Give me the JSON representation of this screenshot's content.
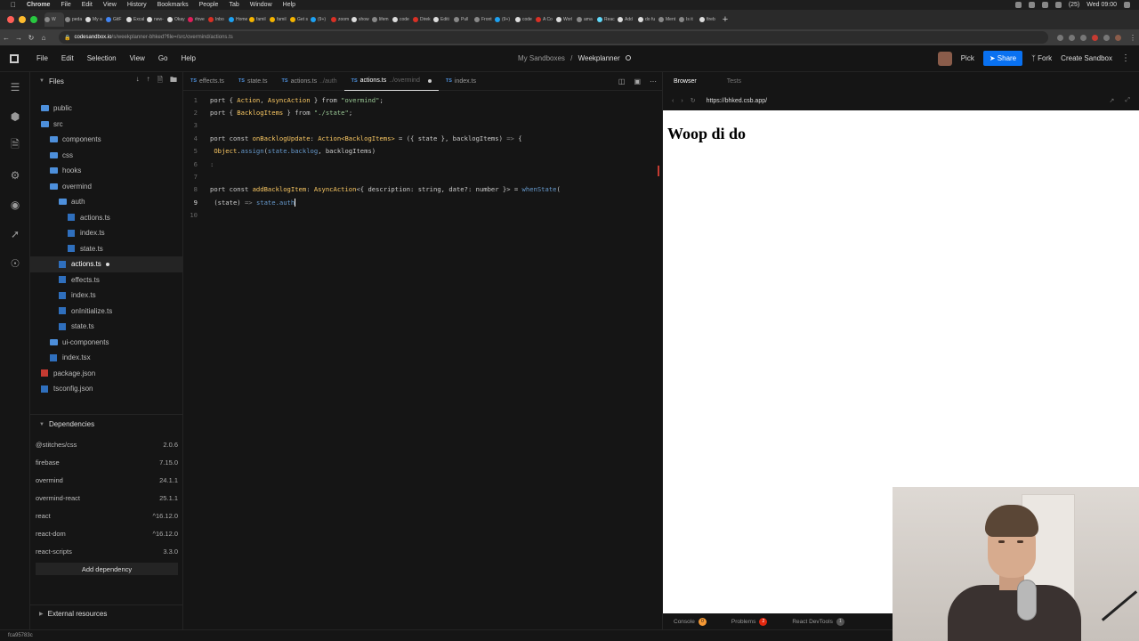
{
  "macbar": {
    "app": "Chrome",
    "menus": [
      "File",
      "Edit",
      "View",
      "History",
      "Bookmarks",
      "People",
      "Tab",
      "Window",
      "Help"
    ],
    "clock": "Wed 09:00",
    "notif": "(25)"
  },
  "chrome": {
    "tabs": [
      {
        "label": "W",
        "color": "#888888"
      },
      {
        "label": "peda",
        "color": "#888888"
      },
      {
        "label": "My a",
        "color": "#dddddd"
      },
      {
        "label": "GitF",
        "color": "#4285f4"
      },
      {
        "label": "Excal",
        "color": "#dddddd"
      },
      {
        "label": "new-",
        "color": "#dddddd"
      },
      {
        "label": "Okay",
        "color": "#dddddd"
      },
      {
        "label": "#ove",
        "color": "#e01e5a"
      },
      {
        "label": "Inbo",
        "color": "#d93025"
      },
      {
        "label": "Home",
        "color": "#1da1f2"
      },
      {
        "label": "famil",
        "color": "#f4b400"
      },
      {
        "label": "famil",
        "color": "#f4b400"
      },
      {
        "label": "Get s",
        "color": "#f4b400"
      },
      {
        "label": "(9+)",
        "color": "#1da1f2"
      },
      {
        "label": "zoom",
        "color": "#d93025"
      },
      {
        "label": "show",
        "color": "#dddddd"
      },
      {
        "label": "lifem",
        "color": "#888888"
      },
      {
        "label": "code",
        "color": "#dddddd"
      },
      {
        "label": "Direk",
        "color": "#d93025"
      },
      {
        "label": "Editi",
        "color": "#dddddd"
      },
      {
        "label": "Pull",
        "color": "#888888"
      },
      {
        "label": "Front",
        "color": "#888888"
      },
      {
        "label": "(9+)",
        "color": "#1da1f2"
      },
      {
        "label": "code",
        "color": "#dddddd"
      },
      {
        "label": "A Co",
        "color": "#d93025"
      },
      {
        "label": "Worl",
        "color": "#dddddd"
      },
      {
        "label": "ama",
        "color": "#888888"
      },
      {
        "label": "Reac",
        "color": "#61dafb"
      },
      {
        "label": "Add",
        "color": "#dddddd"
      },
      {
        "label": "do fu",
        "color": "#dddddd"
      },
      {
        "label": "Ment",
        "color": "#888888"
      },
      {
        "label": "Is it",
        "color": "#888888"
      },
      {
        "label": "fireb",
        "color": "#dddddd"
      }
    ],
    "url_prefix": "codesandbox.io",
    "url_path": "/s/weekplanner-bhked?file=/src/overmind/actions.ts"
  },
  "csheader": {
    "menu": [
      "File",
      "Edit",
      "Selection",
      "View",
      "Go",
      "Help"
    ],
    "crumb_parent": "My Sandboxes",
    "crumb_sep": "/",
    "crumb_current": "Weekplanner",
    "pick": "Pick",
    "share": "Share",
    "fork": "Fork",
    "create": "Create Sandbox"
  },
  "sidebar": {
    "title": "Files",
    "tree": [
      {
        "name": "public",
        "type": "folder",
        "indent": 0
      },
      {
        "name": "src",
        "type": "folder",
        "indent": 0
      },
      {
        "name": "components",
        "type": "folder",
        "indent": 1
      },
      {
        "name": "css",
        "type": "folder",
        "indent": 1
      },
      {
        "name": "hooks",
        "type": "folder",
        "indent": 1
      },
      {
        "name": "overmind",
        "type": "folder",
        "indent": 1
      },
      {
        "name": "auth",
        "type": "folder",
        "indent": 2
      },
      {
        "name": "actions.ts",
        "type": "ts",
        "indent": 3
      },
      {
        "name": "index.ts",
        "type": "ts",
        "indent": 3
      },
      {
        "name": "state.ts",
        "type": "ts",
        "indent": 3
      },
      {
        "name": "actions.ts",
        "type": "ts",
        "indent": 2,
        "selected": true,
        "modified": true
      },
      {
        "name": "effects.ts",
        "type": "ts",
        "indent": 2
      },
      {
        "name": "index.ts",
        "type": "ts",
        "indent": 2
      },
      {
        "name": "onInitialize.ts",
        "type": "ts",
        "indent": 2
      },
      {
        "name": "state.ts",
        "type": "ts",
        "indent": 2
      },
      {
        "name": "ui-components",
        "type": "folder",
        "indent": 1
      },
      {
        "name": "index.tsx",
        "type": "ts",
        "indent": 1
      },
      {
        "name": "package.json",
        "type": "json",
        "indent": 0
      },
      {
        "name": "tsconfig.json",
        "type": "ts",
        "indent": 0
      }
    ],
    "dependencies_title": "Dependencies",
    "dependencies": [
      {
        "name": "@stitches/css",
        "version": "2.0.6"
      },
      {
        "name": "firebase",
        "version": "7.15.0"
      },
      {
        "name": "overmind",
        "version": "24.1.1"
      },
      {
        "name": "overmind-react",
        "version": "25.1.1"
      },
      {
        "name": "react",
        "version": "^16.12.0"
      },
      {
        "name": "react-dom",
        "version": "^16.12.0"
      },
      {
        "name": "react-scripts",
        "version": "3.3.0"
      }
    ],
    "add_dependency": "Add dependency",
    "external_resources": "External resources"
  },
  "editor": {
    "tabs": [
      {
        "name": "effects.ts",
        "sub": ""
      },
      {
        "name": "state.ts",
        "sub": ""
      },
      {
        "name": "actions.ts",
        "sub": "../auth"
      },
      {
        "name": "actions.ts",
        "sub": "../overmind",
        "active": true,
        "modified": true
      },
      {
        "name": "index.ts",
        "sub": ""
      }
    ],
    "lines": [
      {
        "n": "1",
        "parts": [
          [
            "kw",
            "port { "
          ],
          [
            "id",
            "Action"
          ],
          [
            "kw",
            ", "
          ],
          [
            "id",
            "AsyncAction"
          ],
          [
            "kw",
            " } from "
          ],
          [
            "str",
            "\"overmind\""
          ],
          [
            "kw",
            ";"
          ]
        ]
      },
      {
        "n": "2",
        "parts": [
          [
            "kw",
            "port { "
          ],
          [
            "id",
            "BacklogItems"
          ],
          [
            "kw",
            " } from "
          ],
          [
            "str",
            "\"./state\""
          ],
          [
            "kw",
            ";"
          ]
        ]
      },
      {
        "n": "3",
        "parts": []
      },
      {
        "n": "4",
        "parts": [
          [
            "kw",
            "port const "
          ],
          [
            "id",
            "onBacklogUpdate"
          ],
          [
            "kw",
            ": "
          ],
          [
            "typ",
            "Action<BacklogItems>"
          ],
          [
            "kw",
            " = ({ state }, backlogItems) "
          ],
          [
            "mut",
            "=>"
          ],
          [
            "kw",
            " {"
          ]
        ]
      },
      {
        "n": "5",
        "parts": [
          [
            "typ",
            " Object"
          ],
          [
            "kw",
            "."
          ],
          [
            "fn",
            "assign"
          ],
          [
            "kw",
            "("
          ],
          [
            "fn",
            "state.backlog"
          ],
          [
            "kw",
            ", backlogItems)"
          ]
        ]
      },
      {
        "n": "6",
        "parts": [
          [
            "mut",
            ":"
          ]
        ]
      },
      {
        "n": "7",
        "parts": []
      },
      {
        "n": "8",
        "parts": [
          [
            "kw",
            "port const "
          ],
          [
            "id",
            "addBacklogItem"
          ],
          [
            "kw",
            ": "
          ],
          [
            "typ",
            "AsyncAction"
          ],
          [
            "kw",
            "<{ description: string, date?: number }> = "
          ],
          [
            "fn",
            "whenState"
          ],
          [
            "kw",
            "("
          ]
        ]
      },
      {
        "n": "9",
        "parts": [
          [
            "kw",
            " (state) "
          ],
          [
            "mut",
            "=>"
          ],
          [
            "kw",
            " "
          ],
          [
            "fn",
            "state.auth"
          ]
        ],
        "cursor": true,
        "current": true
      },
      {
        "n": "10",
        "parts": []
      }
    ]
  },
  "preview": {
    "tab_browser": "Browser",
    "tab_tests": "Tests",
    "url": "https://bhked.csb.app/",
    "heading": "Woop di do",
    "console": "Console",
    "console_count": "0",
    "problems": "Problems",
    "problems_count": "2",
    "devtools": "React DevTools",
    "devtools_count": "1"
  },
  "status": {
    "hash": "fca95783c"
  }
}
